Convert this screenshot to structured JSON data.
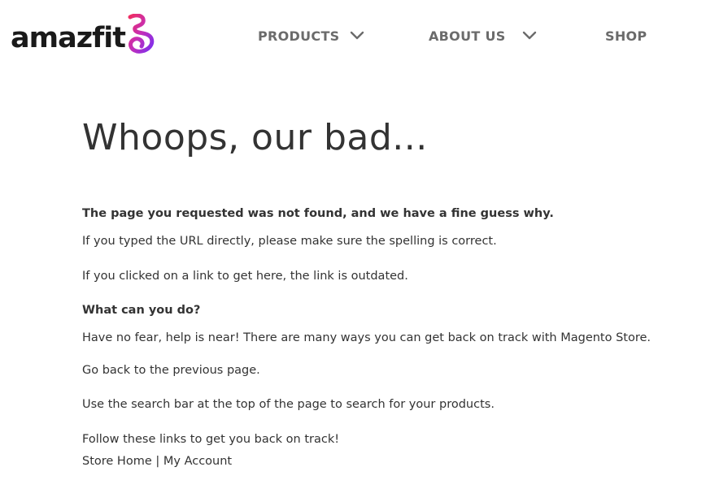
{
  "brand": {
    "logo_text": "amazfit",
    "logo_mark_icon": "amazfit-swirl-icon",
    "gradient_start": "#e5256b",
    "gradient_end": "#7b2ff0"
  },
  "nav": {
    "items": [
      {
        "label": "PRODUCTS",
        "has_dropdown": true
      },
      {
        "label": "ABOUT US",
        "has_dropdown": true
      },
      {
        "label": "SHOP",
        "has_dropdown": false
      }
    ],
    "chevron_icon": "chevron-down-icon"
  },
  "main": {
    "title": "Whoops, our bad...",
    "subtitle": "The page you requested was not found, and we have a fine guess why.",
    "reason_1": "If you typed the URL directly, please make sure the spelling is correct.",
    "reason_2": "If you clicked on a link to get here, the link is outdated.",
    "help_heading": "What can you do?",
    "help_text": "Have no fear, help is near! There are many ways you can get back on track with Magento Store.",
    "go_back": "Go back to the previous page.",
    "search_tip": "Use the search bar at the top of the page to search for your products.",
    "follow_links": "Follow these links to get you back on track!",
    "store_home": "Store Home",
    "separator": " | ",
    "my_account": "My Account"
  },
  "colors": {
    "text": "#333333",
    "nav_text": "#6b6b6b"
  }
}
